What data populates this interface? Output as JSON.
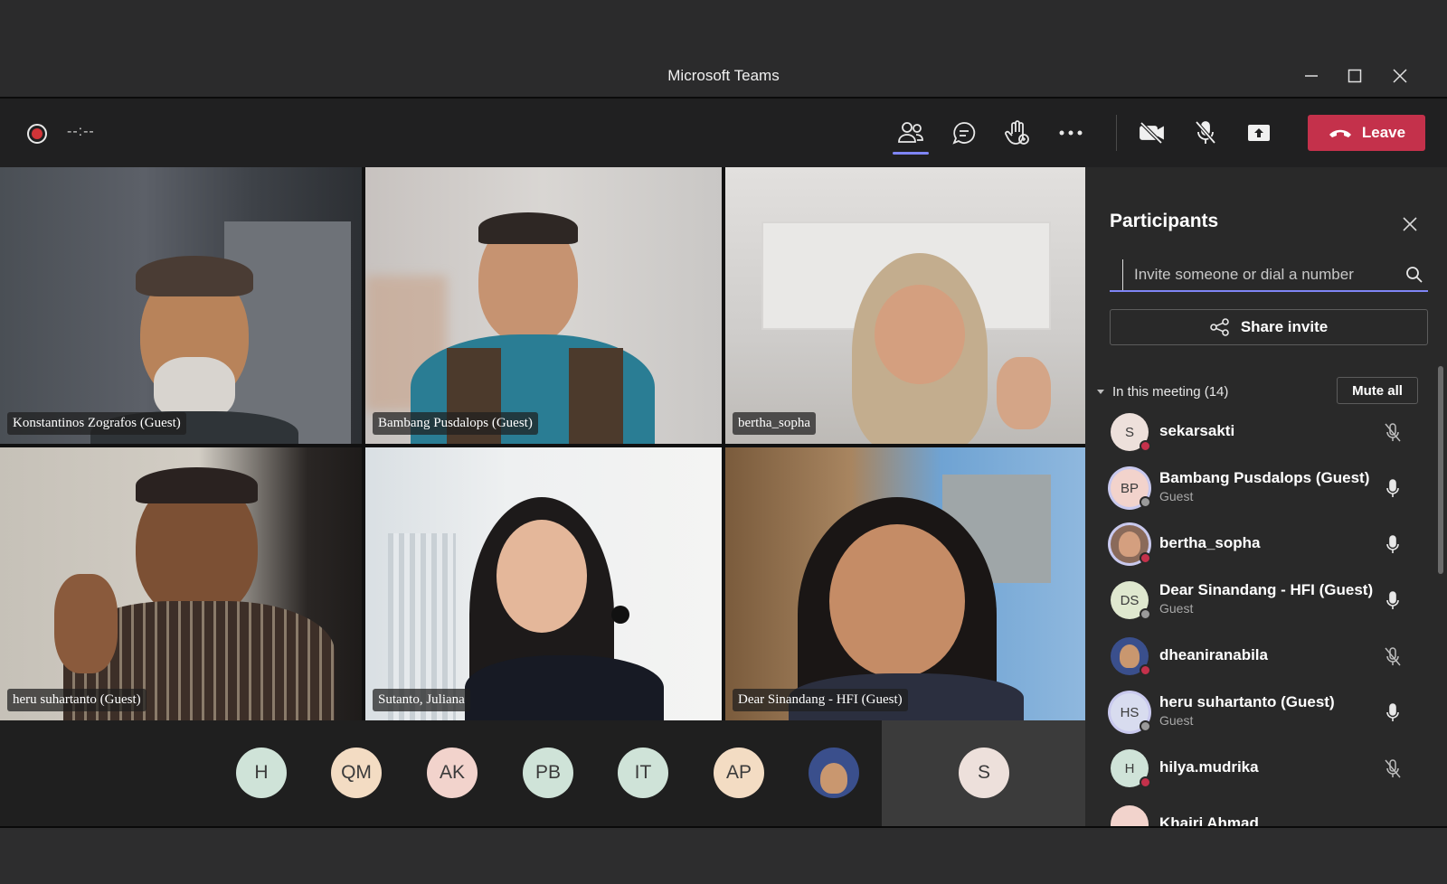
{
  "window": {
    "title": "Microsoft Teams"
  },
  "toolbar": {
    "timer": "--:--",
    "leave_label": "Leave",
    "buttons": [
      "people-icon",
      "chat-icon",
      "raise-hand-icon",
      "more-icon",
      "camera-off-icon",
      "mic-off-icon",
      "share-screen-icon"
    ]
  },
  "videos": [
    {
      "name": "Konstantinos Zografos (Guest)"
    },
    {
      "name": "Bambang Pusdalops (Guest)"
    },
    {
      "name": "bertha_sopha"
    },
    {
      "name": "heru suhartanto (Guest)"
    },
    {
      "name": "Sutanto, Juliana"
    },
    {
      "name": "Dear Sinandang - HFI (Guest)"
    }
  ],
  "avatar_row": [
    {
      "initials": "H",
      "color": "#cfe3d8"
    },
    {
      "initials": "QM",
      "color": "#f3dcc3"
    },
    {
      "initials": "AK",
      "color": "#f2d3cc"
    },
    {
      "initials": "PB",
      "color": "#cfe3d8"
    },
    {
      "initials": "IT",
      "color": "#cfe3d8"
    },
    {
      "initials": "AP",
      "color": "#f3dcc3"
    },
    {
      "initials": "",
      "color": "#3a4f8c"
    },
    {
      "initials": "S",
      "color": "#ede0db"
    }
  ],
  "panel": {
    "title": "Participants",
    "search_placeholder": "Invite someone or dial a number",
    "share_label": "Share invite",
    "section_label": "In this meeting (14)",
    "mute_all_label": "Mute all",
    "participants": [
      {
        "initials": "S",
        "name": "sekarsakti",
        "sub": "",
        "avatar_color": "#ede0db",
        "status": "#c4314b",
        "mic": "mic-off-icon",
        "ring": false,
        "photo": false
      },
      {
        "initials": "BP",
        "name": "Bambang Pusdalops (Guest)",
        "sub": "Guest",
        "avatar_color": "#f2d3cc",
        "status": "#9a9a9a",
        "mic": "mic-on-icon",
        "ring": true,
        "photo": false
      },
      {
        "initials": "",
        "name": "bertha_sopha",
        "sub": "",
        "avatar_color": "#8a6a5a",
        "status": "#c4314b",
        "mic": "mic-on-icon",
        "ring": true,
        "photo": true
      },
      {
        "initials": "DS",
        "name": "Dear Sinandang - HFI (Guest)",
        "sub": "Guest",
        "avatar_color": "#dfe8cf",
        "status": "#9a9a9a",
        "mic": "mic-on-icon",
        "ring": false,
        "photo": false
      },
      {
        "initials": "",
        "name": "dheaniranabila",
        "sub": "",
        "avatar_color": "#3a4f8c",
        "status": "#c4314b",
        "mic": "mic-off-icon",
        "ring": false,
        "photo": true
      },
      {
        "initials": "HS",
        "name": "heru suhartanto (Guest)",
        "sub": "Guest",
        "avatar_color": "#d8dcef",
        "status": "#9a9a9a",
        "mic": "mic-on-icon",
        "ring": true,
        "photo": false
      },
      {
        "initials": "H",
        "name": "hilya.mudrika",
        "sub": "",
        "avatar_color": "#cfe3d8",
        "status": "#c4314b",
        "mic": "mic-off-icon",
        "ring": false,
        "photo": false
      },
      {
        "initials": "",
        "name": "Khairi Ahmad",
        "sub": "",
        "avatar_color": "#f2d3cc",
        "status": "#9a9a9a",
        "mic": "mic-off-icon",
        "ring": false,
        "photo": false
      }
    ]
  }
}
